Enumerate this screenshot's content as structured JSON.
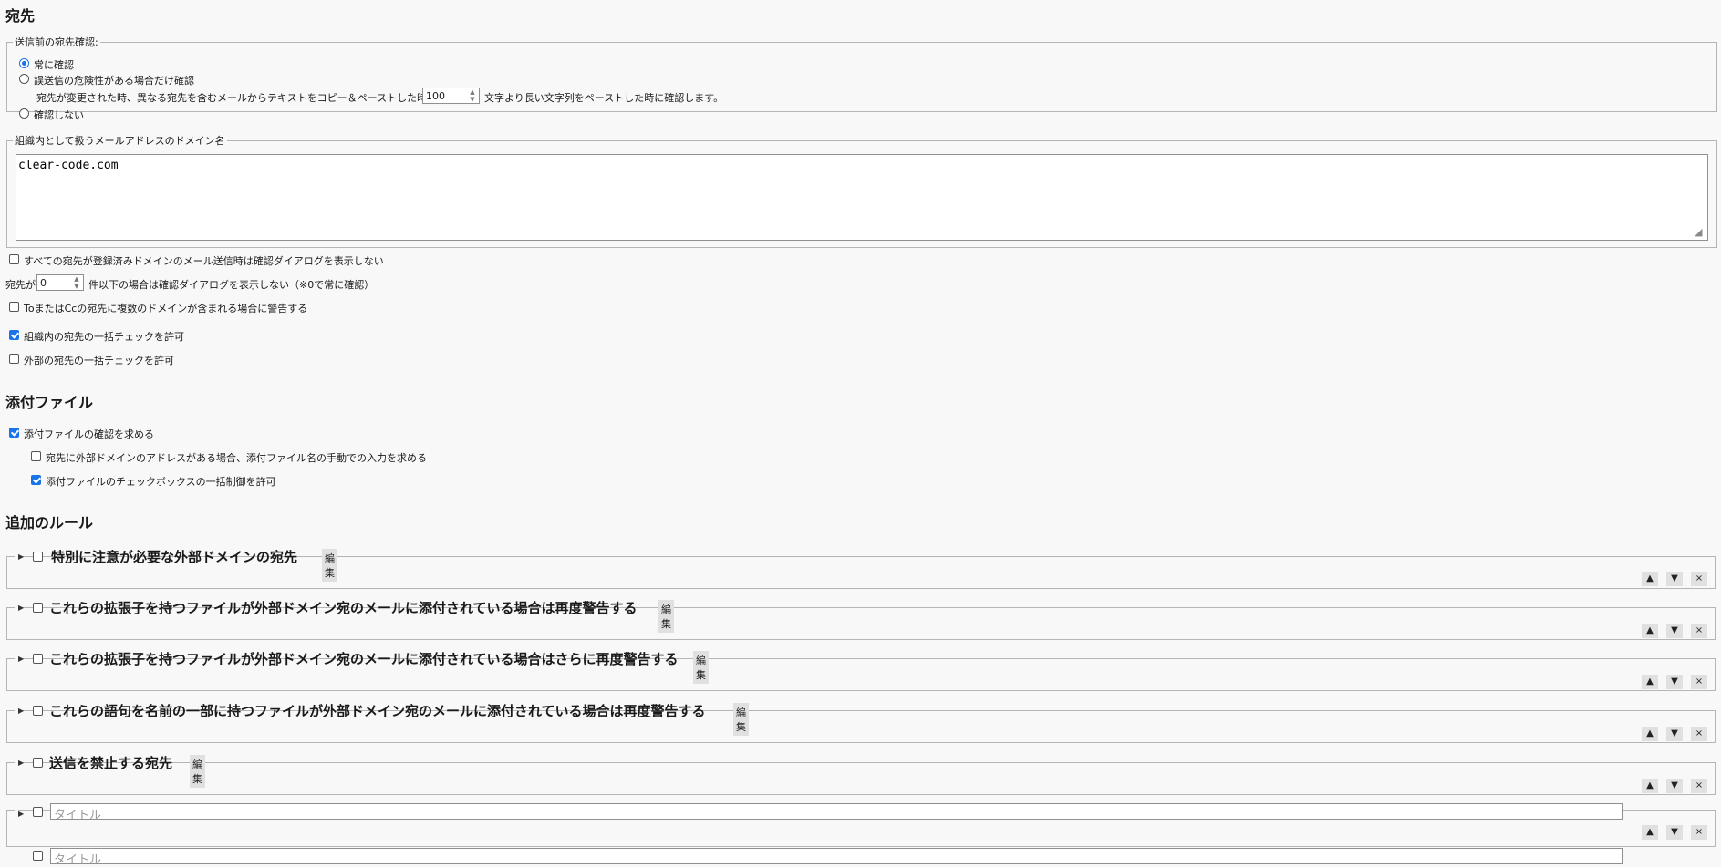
{
  "recipients": {
    "heading": "宛先",
    "confirm_group": {
      "legend": "送信前の宛先確認:",
      "options": [
        {
          "label": "常に確認",
          "selected": true
        },
        {
          "label": "誤送信の危険性がある場合だけ確認",
          "selected": false
        },
        {
          "label": "確認しない",
          "selected": false
        }
      ],
      "paste_note_before": "宛先が変更された時、異なる宛先を含むメールからテキストをコピー＆ペーストした時、および",
      "paste_threshold": "100",
      "paste_note_after": "文字より長い文字列をペーストした時に確認します。"
    },
    "internal_domains": {
      "legend": "組織内として扱うメールアドレスのドメイン名",
      "value": "clear-code.com"
    },
    "skip_if_all_internal": {
      "label": "すべての宛先が登録済みドメインのメール送信時は確認ダイアログを表示しない",
      "checked": false
    },
    "min_recipients": {
      "prefix": "宛先が",
      "value": "0",
      "suffix": "件以下の場合は確認ダイアログを表示しない（※0で常に確認）"
    },
    "warn_multiple_domains": {
      "label": "ToまたはCcの宛先に複数のドメインが含まれる場合に警告する",
      "checked": false
    },
    "allow_bulk_internal": {
      "label": "組織内の宛先の一括チェックを許可",
      "checked": true
    },
    "allow_bulk_external": {
      "label": "外部の宛先の一括チェックを許可",
      "checked": false
    }
  },
  "attachments": {
    "heading": "添付ファイル",
    "require_confirm": {
      "label": "添付ファイルの確認を求める",
      "checked": true
    },
    "require_manual_name": {
      "label": "宛先に外部ドメインのアドレスがある場合、添付ファイル名の手動での入力を求める",
      "checked": false
    },
    "allow_bulk_control": {
      "label": "添付ファイルのチェックボックスの一括制御を許可",
      "checked": true
    }
  },
  "rules": {
    "heading": "追加のルール",
    "edit_label": "編集",
    "title_placeholder": "タイトル",
    "controls": {
      "up": "▲",
      "down": "▼",
      "remove": "×"
    },
    "items": [
      {
        "title": "特別に注意が必要な外部ドメインの宛先",
        "checked": false
      },
      {
        "title": "これらの拡張子を持つファイルが外部ドメイン宛のメールに添付されている場合は再度警告する",
        "checked": false
      },
      {
        "title": "これらの拡張子を持つファイルが外部ドメイン宛のメールに添付されている場合はさらに再度警告する",
        "checked": false
      },
      {
        "title": "これらの語句を名前の一部に持つファイルが外部ドメイン宛のメールに添付されている場合は再度警告する",
        "checked": false
      },
      {
        "title": "送信を禁止する宛先",
        "checked": false
      }
    ]
  }
}
